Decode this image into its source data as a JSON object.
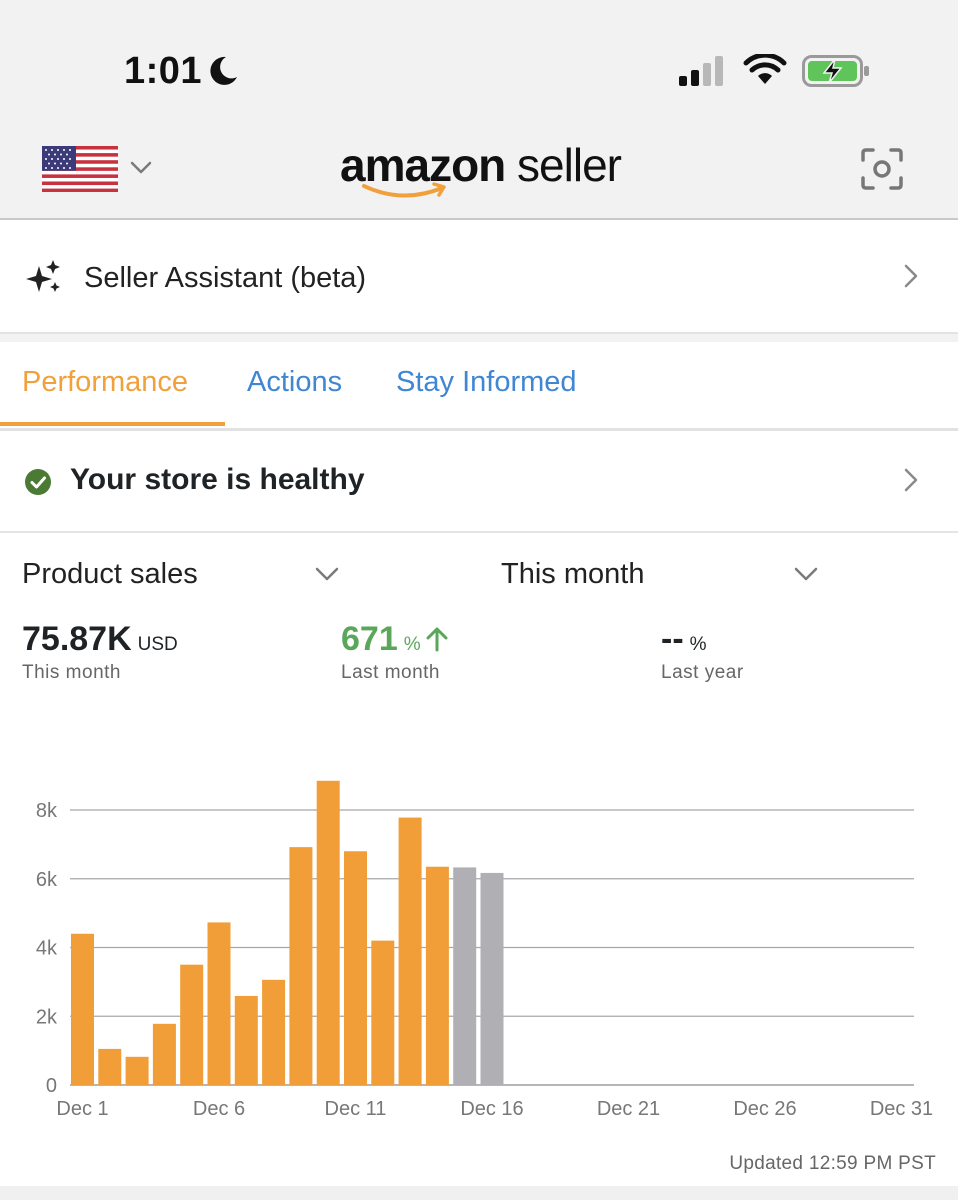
{
  "status_bar": {
    "time": "1:01",
    "icons": [
      "moon-icon",
      "cellular-signal-icon",
      "wifi-icon",
      "battery-charging-icon"
    ]
  },
  "header": {
    "country_flag": "us-flag-icon",
    "logo_bold": "amazon",
    "logo_light": "seller",
    "scan_icon": "scan-icon"
  },
  "assistant": {
    "label": "Seller Assistant (beta)"
  },
  "tabs": [
    {
      "label": "Performance",
      "active": true
    },
    {
      "label": "Actions",
      "active": false
    },
    {
      "label": "Stay Informed",
      "active": false
    }
  ],
  "health": {
    "label": "Your store is healthy"
  },
  "selectors": {
    "metric": "Product sales",
    "period": "This month"
  },
  "metrics": {
    "current": {
      "value": "75.87K",
      "unit": "USD",
      "caption": "This month"
    },
    "vs_last_month": {
      "value": "671",
      "unit": "%",
      "caption": "Last month"
    },
    "vs_last_year": {
      "value": "--",
      "unit": "%",
      "caption": "Last year"
    }
  },
  "colors": {
    "accent_orange": "#f19d38",
    "projected_gray": "#b0b0b4",
    "link_blue": "#3f86d3",
    "positive_green": "#5aa65a",
    "health_green": "#4a7a34"
  },
  "chart_data": {
    "type": "bar",
    "title": "",
    "xlabel": "",
    "ylabel": "",
    "ylim": [
      0,
      8000
    ],
    "grid": true,
    "x_tick_labels": [
      "Dec 1",
      "Dec 6",
      "Dec 11",
      "Dec 16",
      "Dec 21",
      "Dec 26",
      "Dec 31"
    ],
    "y_tick_labels": [
      "0",
      "2k",
      "4k",
      "6k",
      "8k"
    ],
    "y_ticks": [
      0,
      2000,
      4000,
      6000,
      8000
    ],
    "series": [
      {
        "values": [
          4400,
          1050,
          820,
          1780,
          3500,
          4730,
          2590,
          3060,
          6920,
          8850,
          6800,
          4200,
          7780,
          6350,
          null,
          null
        ]
      },
      {
        "values": [
          null,
          null,
          null,
          null,
          null,
          null,
          null,
          null,
          null,
          null,
          null,
          null,
          null,
          null,
          6330,
          6170
        ]
      }
    ],
    "categories_days": [
      1,
      2,
      3,
      4,
      5,
      6,
      7,
      8,
      9,
      10,
      11,
      12,
      13,
      14,
      15,
      16
    ]
  },
  "updated": "Updated 12:59 PM PST"
}
